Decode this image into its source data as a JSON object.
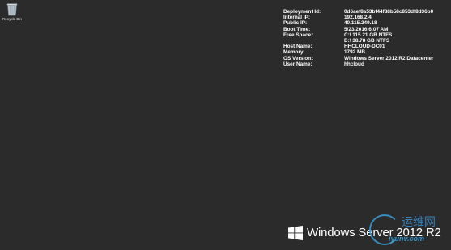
{
  "desktop": {
    "icons": [
      {
        "label": "Recycle Bin",
        "icon": "recycle-bin-icon"
      }
    ]
  },
  "sysinfo": {
    "rows": [
      {
        "key": "Deployment Id:",
        "value": "0d6aef8a53bf44f88b58c853df8d36b0"
      },
      {
        "key": "Internal IP:",
        "value": "192.168.2.4"
      },
      {
        "key": "Public IP:",
        "value": "40.115.249.18"
      },
      {
        "key": "Boot Time:",
        "value": "5/23/2016 6:07 AM"
      },
      {
        "key": "Free Space:",
        "value": "C:\\ 115.21 GB NTFS"
      },
      {
        "key": "",
        "value": "D:\\ 38.78 GB NTFS"
      },
      {
        "key": "Host Name:",
        "value": "HHCLOUD-DC01"
      },
      {
        "key": "Memory:",
        "value": "1792 MB"
      },
      {
        "key": "OS Version:",
        "value": "Windows Server 2012 R2 Datacenter"
      },
      {
        "key": "User Name:",
        "value": "hhcloud"
      }
    ]
  },
  "branding": {
    "os_name": "Windows Server 2012 R2",
    "logo_icon": "windows-logo-icon"
  },
  "watermark": {
    "text_cn": "运维网",
    "domain": "iyunv.com"
  },
  "colors": {
    "desktop_bg": "#2b2b2b",
    "text": "#ffffff",
    "watermark": "#3aa0d8"
  }
}
